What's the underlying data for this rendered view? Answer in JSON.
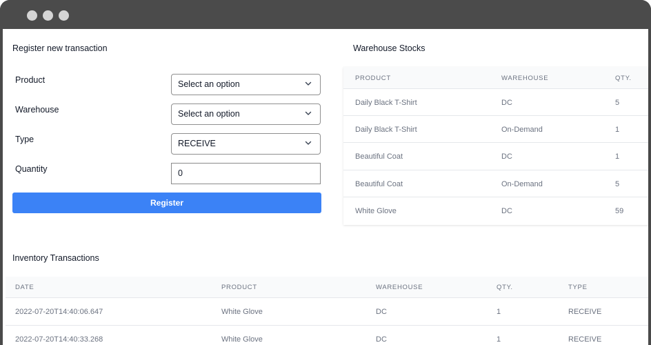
{
  "form": {
    "title": "Register new transaction",
    "fields": [
      {
        "label": "Product",
        "value": "Select an option"
      },
      {
        "label": "Warehouse",
        "value": "Select an option"
      },
      {
        "label": "Type",
        "value": "RECEIVE"
      },
      {
        "label": "Quantity",
        "value": "0"
      }
    ],
    "submit_label": "Register"
  },
  "stocks": {
    "title": "Warehouse Stocks",
    "columns": [
      "PRODUCT",
      "WAREHOUSE",
      "QTY."
    ],
    "rows": [
      [
        "Daily Black T-Shirt",
        "DC",
        "5"
      ],
      [
        "Daily Black T-Shirt",
        "On-Demand",
        "1"
      ],
      [
        "Beautiful Coat",
        "DC",
        "1"
      ],
      [
        "Beautiful Coat",
        "On-Demand",
        "5"
      ],
      [
        "White Glove",
        "DC",
        "59"
      ]
    ]
  },
  "transactions": {
    "title": "Inventory Transactions",
    "columns": [
      "DATE",
      "PRODUCT",
      "WAREHOUSE",
      "QTY.",
      "TYPE"
    ],
    "rows": [
      [
        "2022-07-20T14:40:06.647",
        "White Glove",
        "DC",
        "1",
        "RECEIVE"
      ],
      [
        "2022-07-20T14:40:33.268",
        "White Glove",
        "DC",
        "1",
        "RECEIVE"
      ]
    ]
  },
  "colors": {
    "accent": "#3b82f6",
    "window_chrome": "#4b4b4b"
  },
  "icons": {
    "select_arrow": "chevron-down-icon",
    "window_controls": [
      "window-dot-icon",
      "window-dot-icon",
      "window-dot-icon"
    ]
  }
}
